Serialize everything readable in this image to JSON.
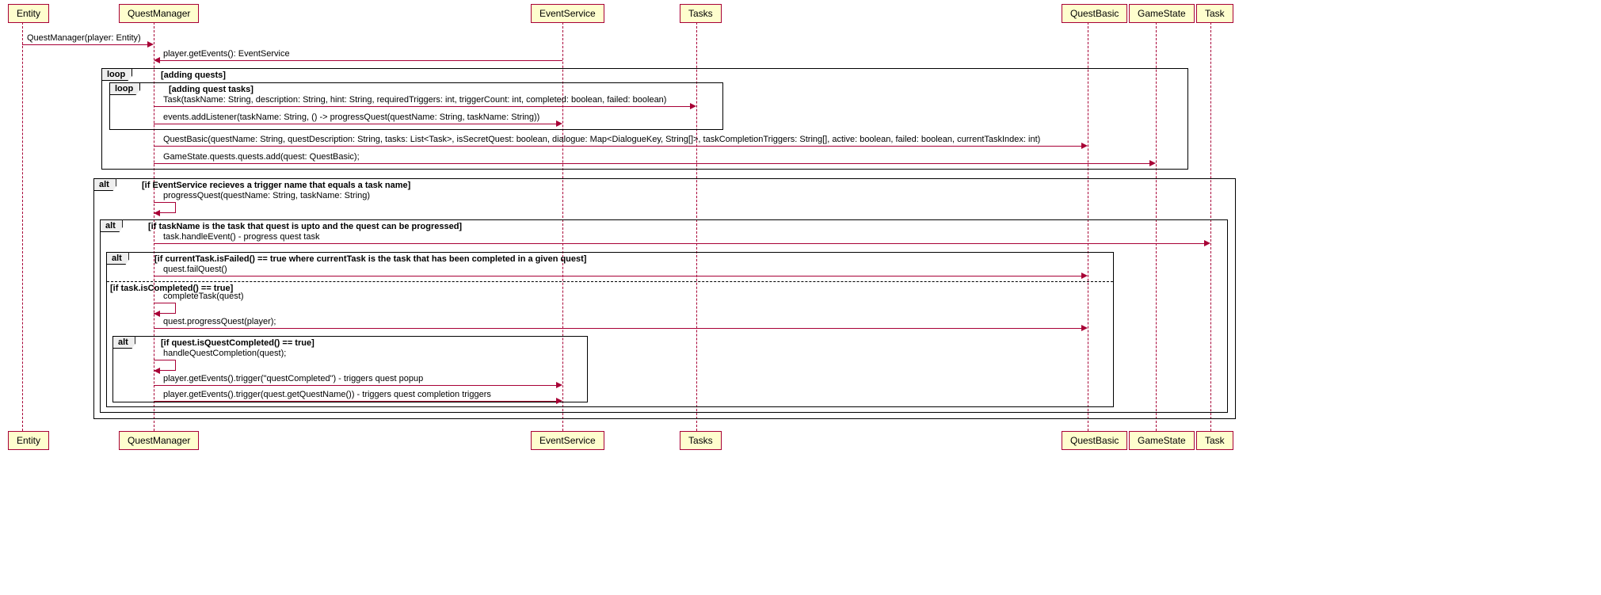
{
  "participants": {
    "entity": "Entity",
    "questManager": "QuestManager",
    "eventService": "EventService",
    "tasks": "Tasks",
    "questBasic": "QuestBasic",
    "gameState": "GameState",
    "task": "Task"
  },
  "messages": {
    "m1": "QuestManager(player: Entity)",
    "m2": "player.getEvents(): EventService",
    "m3": "Task(taskName: String, description: String, hint: String, requiredTriggers: int, triggerCount: int, completed: boolean, failed: boolean)",
    "m4": "events.addListener(taskName: String, () -> progressQuest(questName: String, taskName: String))",
    "m5": "QuestBasic(questName: String, questDescription: String, tasks: List<Task>, isSecretQuest: boolean, dialogue: Map<DialogueKey, String[]>, taskCompletionTriggers: String[], active: boolean, failed: boolean, currentTaskIndex: int)",
    "m6": "GameState.quests.quests.add(quest: QuestBasic);",
    "m7": "progressQuest(questName: String, taskName: String)",
    "m8": "task.handleEvent() - progress quest task",
    "m9": "quest.failQuest()",
    "m10": "completeTask(quest)",
    "m11": "quest.progressQuest(player);",
    "m12": "handleQuestCompletion(quest);",
    "m13": "player.getEvents().trigger(\"questCompleted\") - triggers quest popup",
    "m14": "player.getEvents().trigger(quest.getQuestName()) - triggers quest completion triggers"
  },
  "fragments": {
    "loop1": {
      "label": "loop",
      "guard": "[adding quests]"
    },
    "loop2": {
      "label": "loop",
      "guard": "[adding quest tasks]"
    },
    "alt1": {
      "label": "alt",
      "guard": "[if EventService recieves a trigger name that equals a task name]"
    },
    "alt2": {
      "label": "alt",
      "guard": "[if taskName is the task that quest is upto and the quest can be progressed]"
    },
    "alt3": {
      "label": "alt",
      "guard": "[if currentTask.isFailed() == true where currentTask is the task that has been completed in a given quest]",
      "else": "[if task.isCompleted() == true]"
    },
    "alt4": {
      "label": "alt",
      "guard": "[if quest.isQuestCompleted() == true]"
    }
  },
  "lifelines": {
    "entity": 28,
    "questManager": 194,
    "eventService": 710,
    "tasks": 879,
    "questBasic": 1373,
    "gameState": 1459,
    "task": 1528
  },
  "chart_data": {
    "type": "uml-sequence",
    "participants": [
      "Entity",
      "QuestManager",
      "EventService",
      "Tasks",
      "QuestBasic",
      "GameState",
      "Task"
    ],
    "interactions": [
      {
        "from": "Entity",
        "to": "QuestManager",
        "label": "QuestManager(player: Entity)",
        "kind": "sync"
      },
      {
        "from": "EventService",
        "to": "QuestManager",
        "label": "player.getEvents(): EventService",
        "kind": "sync"
      },
      {
        "frag": "loop",
        "guard": "adding quests",
        "children": [
          {
            "frag": "loop",
            "guard": "adding quest tasks",
            "children": [
              {
                "from": "QuestManager",
                "to": "Tasks",
                "label": "Task(taskName: String, description: String, hint: String, requiredTriggers: int, triggerCount: int, completed: boolean, failed: boolean)",
                "kind": "sync"
              },
              {
                "from": "QuestManager",
                "to": "EventService",
                "label": "events.addListener(taskName: String, () -> progressQuest(questName: String, taskName: String))",
                "kind": "sync"
              }
            ]
          },
          {
            "from": "QuestManager",
            "to": "QuestBasic",
            "label": "QuestBasic(questName: String, questDescription: String, tasks: List<Task>, isSecretQuest: boolean, dialogue: Map<DialogueKey, String[]>, taskCompletionTriggers: String[], active: boolean, failed: boolean, currentTaskIndex: int)",
            "kind": "sync"
          },
          {
            "from": "QuestManager",
            "to": "GameState",
            "label": "GameState.quests.quests.add(quest: QuestBasic);",
            "kind": "sync"
          }
        ]
      },
      {
        "frag": "alt",
        "guard": "if EventService recieves a trigger name that equals a task name",
        "children": [
          {
            "from": "QuestManager",
            "to": "QuestManager",
            "label": "progressQuest(questName: String, taskName: String)",
            "kind": "self"
          },
          {
            "frag": "alt",
            "guard": "if taskName is the task that quest is upto and the quest can be progressed",
            "children": [
              {
                "from": "QuestManager",
                "to": "Task",
                "label": "task.handleEvent() - progress quest task",
                "kind": "sync"
              },
              {
                "frag": "alt",
                "guard": "if currentTask.isFailed() == true where currentTask is the task that has been completed in a given quest",
                "children": [
                  {
                    "from": "QuestManager",
                    "to": "QuestBasic",
                    "label": "quest.failQuest()",
                    "kind": "sync"
                  }
                ],
                "else_guard": "if task.isCompleted() == true",
                "else_children": [
                  {
                    "from": "QuestManager",
                    "to": "QuestManager",
                    "label": "completeTask(quest)",
                    "kind": "self"
                  },
                  {
                    "from": "QuestManager",
                    "to": "QuestBasic",
                    "label": "quest.progressQuest(player);",
                    "kind": "sync"
                  },
                  {
                    "frag": "alt",
                    "guard": "if quest.isQuestCompleted() == true",
                    "children": [
                      {
                        "from": "QuestManager",
                        "to": "QuestManager",
                        "label": "handleQuestCompletion(quest);",
                        "kind": "self"
                      },
                      {
                        "from": "QuestManager",
                        "to": "EventService",
                        "label": "player.getEvents().trigger(\"questCompleted\") - triggers quest popup",
                        "kind": "sync"
                      },
                      {
                        "from": "QuestManager",
                        "to": "EventService",
                        "label": "player.getEvents().trigger(quest.getQuestName()) - triggers quest completion triggers",
                        "kind": "sync"
                      }
                    ]
                  }
                ]
              }
            ]
          }
        ]
      }
    ]
  }
}
